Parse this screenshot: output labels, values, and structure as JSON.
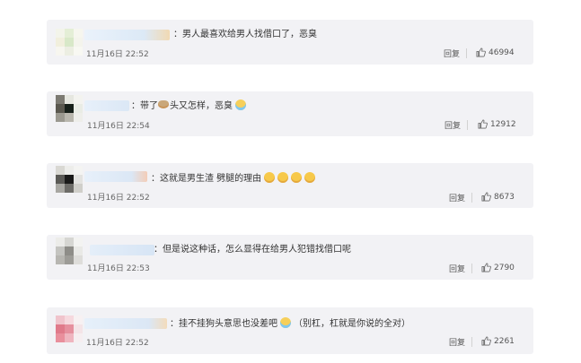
{
  "comments": [
    {
      "text": "：男人最喜欢给男人找借口了，恶臭",
      "emojis": [],
      "time": "11月16日 22:52",
      "reply": "回复",
      "likes": "46994"
    },
    {
      "text": "：带了",
      "text2": "头又怎样，恶臭",
      "emojis": [
        "cry"
      ],
      "time": "11月16日 22:54",
      "reply": "回复",
      "likes": "12912"
    },
    {
      "text": "：这就是男生渣 劈腿的理由",
      "emojis": [
        "smile",
        "smile",
        "smile",
        "smile"
      ],
      "time": "11月16日 22:52",
      "reply": "回复",
      "likes": "8673"
    },
    {
      "text": "：但是说这种话，怎么显得在给男人犯错找借口呢",
      "emojis": [],
      "time": "11月16日 22:53",
      "reply": "回复",
      "likes": "2790"
    },
    {
      "text": "：挂不挂狗头意思也没差吧",
      "text2": "（别杠，杠就是你说的全对）",
      "emojis": [
        "cry"
      ],
      "time": "11月16日 22:52",
      "reply": "回复",
      "likes": "2261"
    }
  ]
}
